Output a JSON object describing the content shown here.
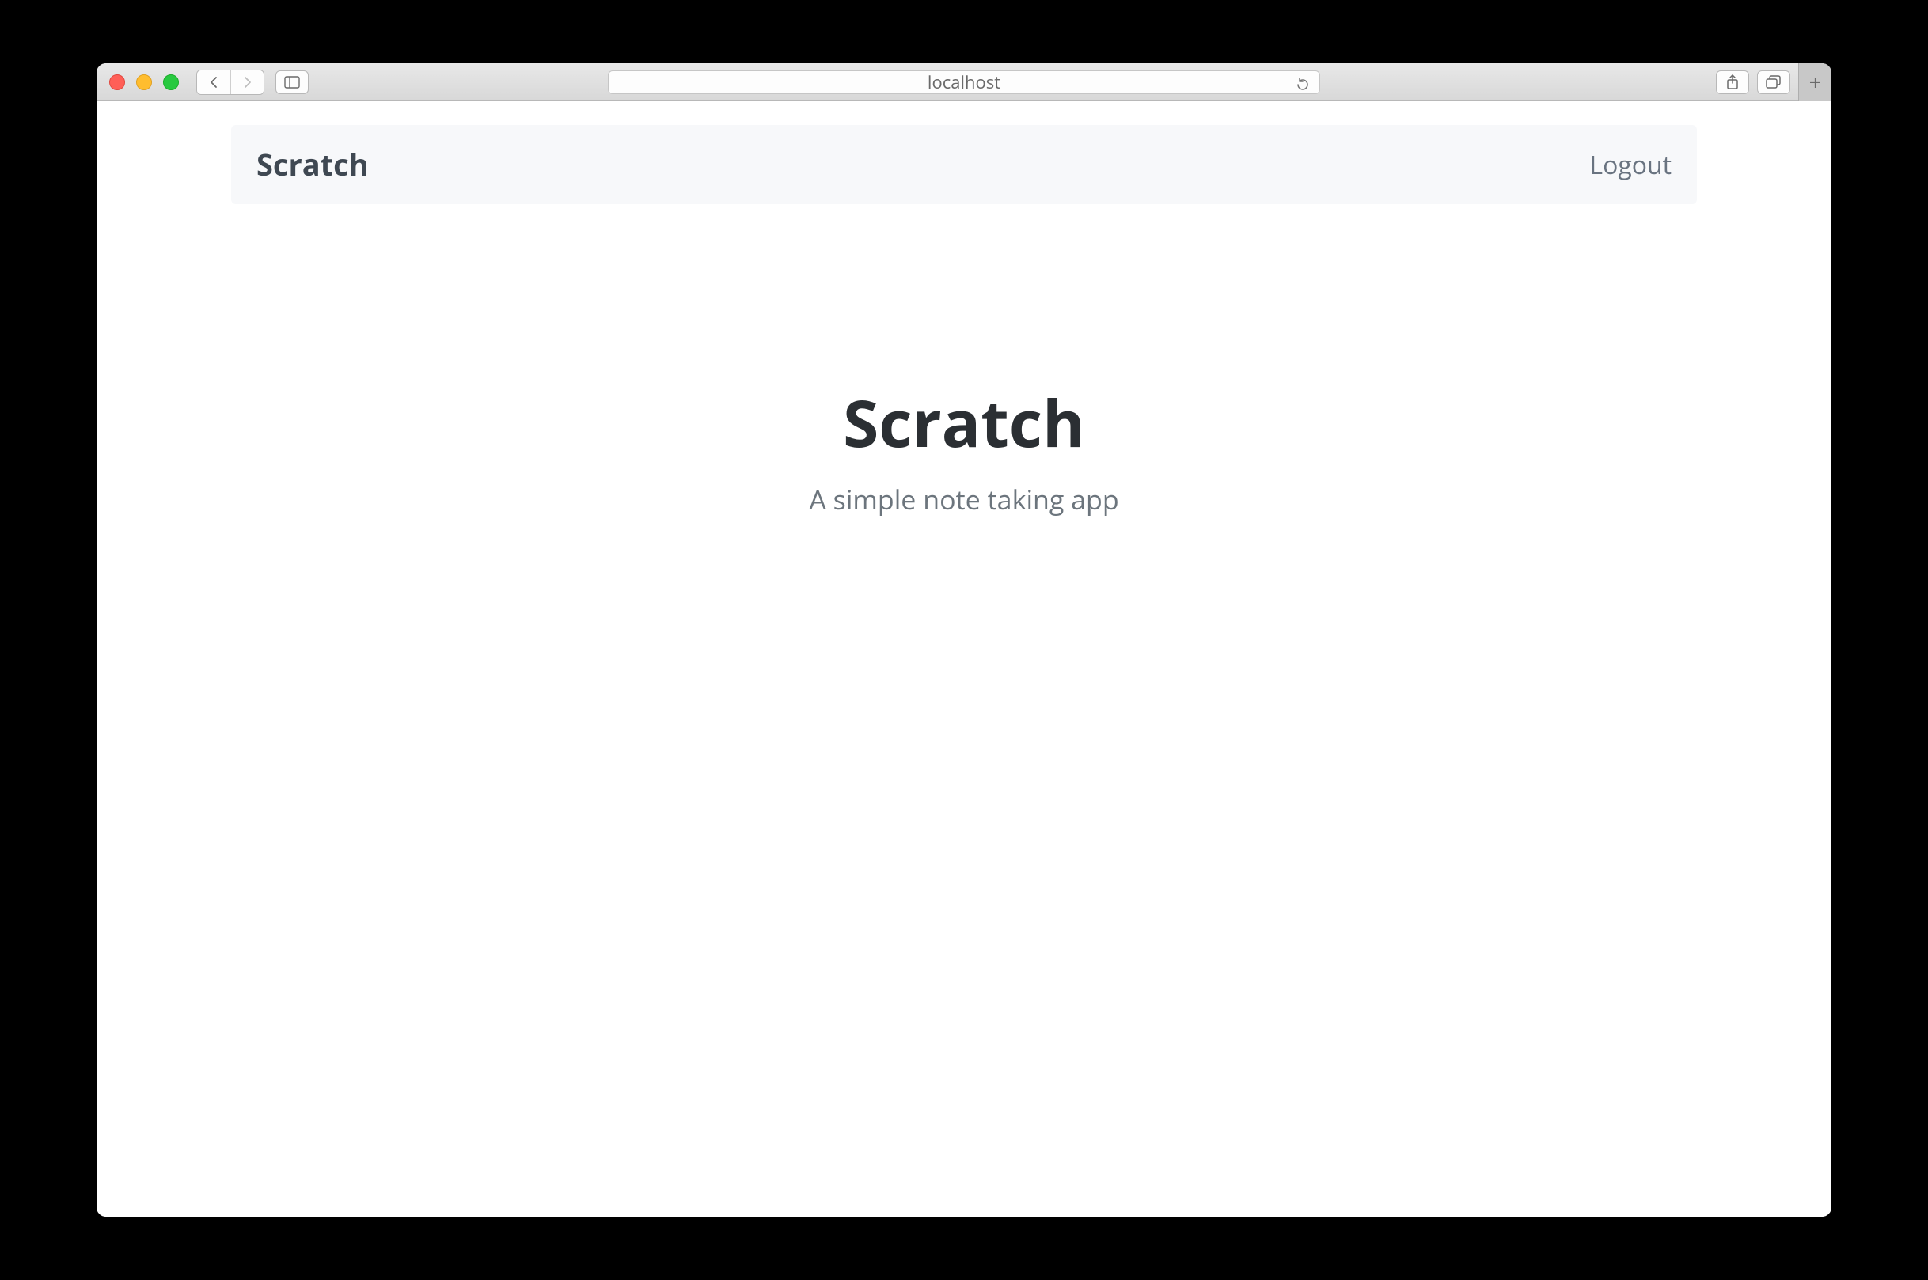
{
  "browser": {
    "url": "localhost"
  },
  "navbar": {
    "brand": "Scratch",
    "logout_label": "Logout"
  },
  "hero": {
    "title": "Scratch",
    "subtitle": "A simple note taking app"
  }
}
